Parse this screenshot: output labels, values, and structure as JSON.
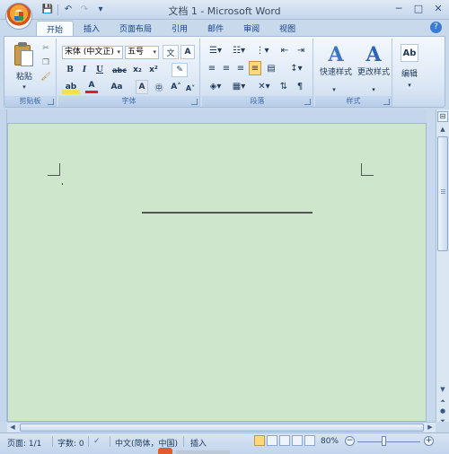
{
  "window": {
    "title": "文档 1 - Microsoft Word",
    "minimize": "─",
    "maximize": "□",
    "close": "✕"
  },
  "qat": {
    "save": "💾",
    "undo": "↶",
    "redo": "↷",
    "customize": "▾"
  },
  "tabs": [
    {
      "label": "开始",
      "active": true
    },
    {
      "label": "插入"
    },
    {
      "label": "页面布局"
    },
    {
      "label": "引用"
    },
    {
      "label": "邮件"
    },
    {
      "label": "审阅"
    },
    {
      "label": "视图"
    }
  ],
  "ribbon": {
    "clipboard": {
      "paste_label": "粘贴",
      "group_label": "剪贴板"
    },
    "font": {
      "font_name": "宋体 (中文正)",
      "font_size": "五号",
      "group_label": "字体",
      "bold": "B",
      "italic": "I",
      "underline": "U",
      "strike": "abc",
      "subscript": "x₂",
      "superscript": "x²",
      "change_case": "Aa",
      "grow": "A˄",
      "shrink": "A˅",
      "char_border": "A",
      "phonetic": "文",
      "clear": "✎",
      "highlight": "ab",
      "font_color": "A",
      "enclose": "㊥"
    },
    "paragraph": {
      "group_label": "段落"
    },
    "styles": {
      "group_label": "样式",
      "quick_styles": "快速样式",
      "change_styles": "更改样式"
    },
    "editing": {
      "label": "编辑"
    }
  },
  "status": {
    "page": "页面: 1/1",
    "words": "字数: 0",
    "language": "中文(简体，中国)",
    "mode": "插入",
    "zoom": "80%"
  },
  "colors": {
    "document_background": "#cde6cc",
    "chrome": "#c9d9ec",
    "accent": "#15428b"
  }
}
